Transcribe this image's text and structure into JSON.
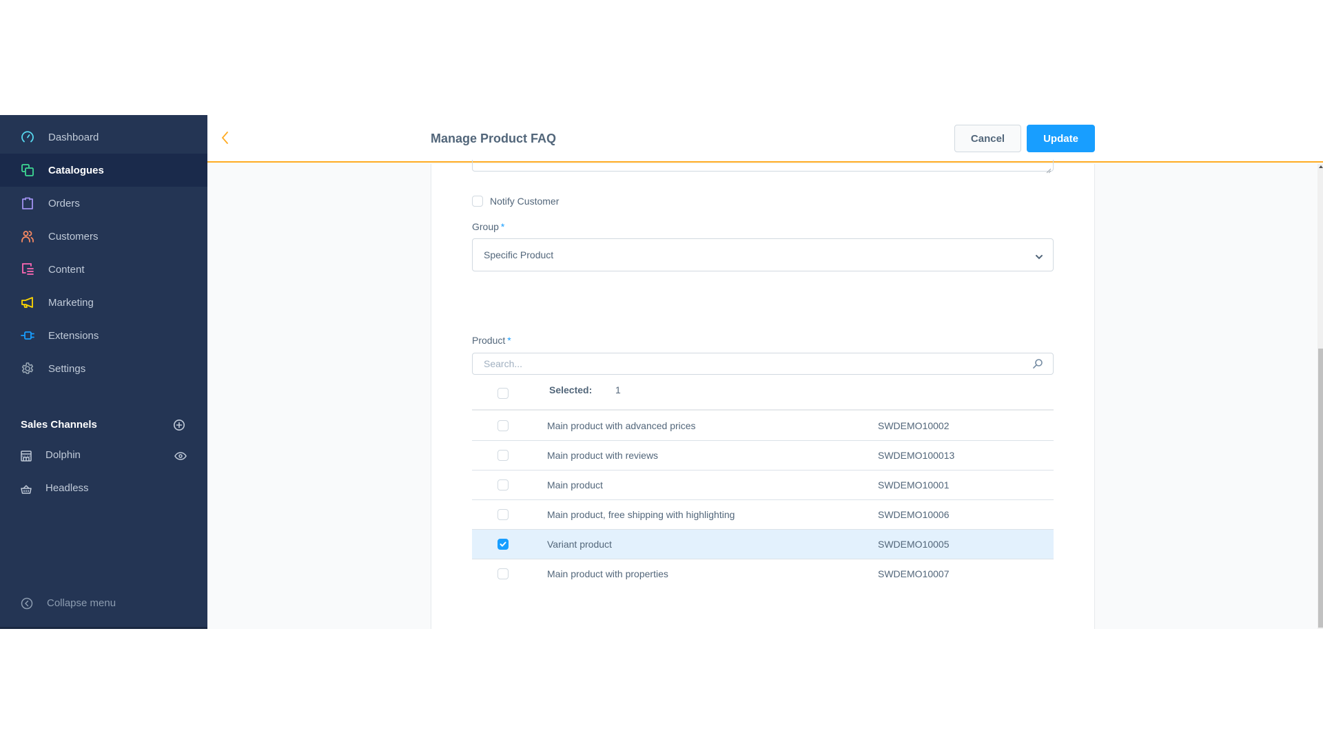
{
  "sidebar": {
    "items": [
      {
        "label": "Dashboard",
        "icon": "dashboard-gauge-icon",
        "color": "#57d9f0",
        "active": false
      },
      {
        "label": "Catalogues",
        "icon": "catalogues-icon",
        "color": "#3ed993",
        "active": true
      },
      {
        "label": "Orders",
        "icon": "orders-bag-icon",
        "color": "#a092f0",
        "active": false
      },
      {
        "label": "Customers",
        "icon": "customers-icon",
        "color": "#f88962",
        "active": false
      },
      {
        "label": "Content",
        "icon": "content-icon",
        "color": "#ff68b4",
        "active": false
      },
      {
        "label": "Marketing",
        "icon": "marketing-megaphone-icon",
        "color": "#ffd700",
        "active": false
      },
      {
        "label": "Extensions",
        "icon": "extensions-plug-icon",
        "color": "#189eff",
        "active": false
      },
      {
        "label": "Settings",
        "icon": "settings-gear-icon",
        "color": "#9aa8b5",
        "active": false
      }
    ],
    "sales_channels": {
      "title": "Sales Channels",
      "items": [
        {
          "label": "Dolphin",
          "icon": "storefront-icon"
        },
        {
          "label": "Headless",
          "icon": "basket-icon"
        }
      ]
    },
    "collapse_label": "Collapse menu"
  },
  "header": {
    "title": "Manage Product FAQ",
    "cancel_label": "Cancel",
    "update_label": "Update",
    "accent_color": "#ffab22",
    "primary_color": "#189eff"
  },
  "form": {
    "notify_customer_label": "Notify Customer",
    "notify_customer_checked": false,
    "group_label": "Group",
    "group_value": "Specific Product",
    "product_label": "Product",
    "required_marker": "*",
    "search_placeholder": "Search...",
    "selected_label": "Selected:",
    "selected_count": "1",
    "products": [
      {
        "name": "Main product with advanced prices",
        "sku": "SWDEMO10002",
        "checked": false
      },
      {
        "name": "Main product with reviews",
        "sku": "SWDEMO100013",
        "checked": false
      },
      {
        "name": "Main product",
        "sku": "SWDEMO10001",
        "checked": false
      },
      {
        "name": "Main product, free shipping with highlighting",
        "sku": "SWDEMO10006",
        "checked": false
      },
      {
        "name": "Variant product",
        "sku": "SWDEMO10005",
        "checked": true
      },
      {
        "name": "Main product with properties",
        "sku": "SWDEMO10007",
        "checked": false
      }
    ]
  }
}
